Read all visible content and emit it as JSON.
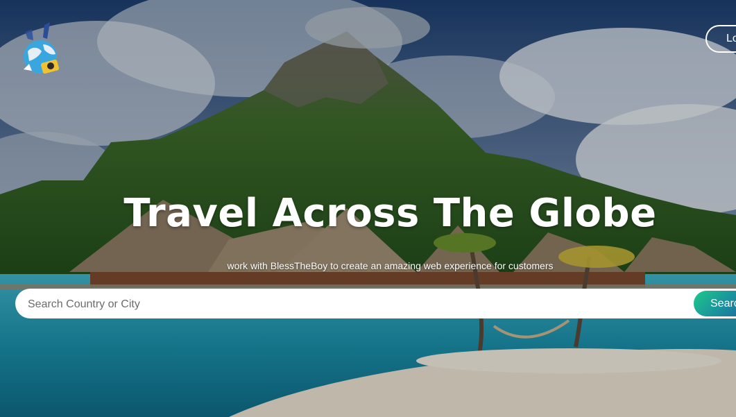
{
  "header": {
    "logo_icon": "globe-camera-logo-icon",
    "login_label": "Lo"
  },
  "hero": {
    "title": "Travel Across The Globe",
    "subtitle": "work with BlessTheBoy to create an amazing web experience for customers"
  },
  "search": {
    "placeholder": "Search Country or City",
    "value": "",
    "button_label": "Searc"
  },
  "colors": {
    "accent_start": "#1cc98b",
    "accent_end": "#25509e",
    "text": "#ffffff"
  }
}
